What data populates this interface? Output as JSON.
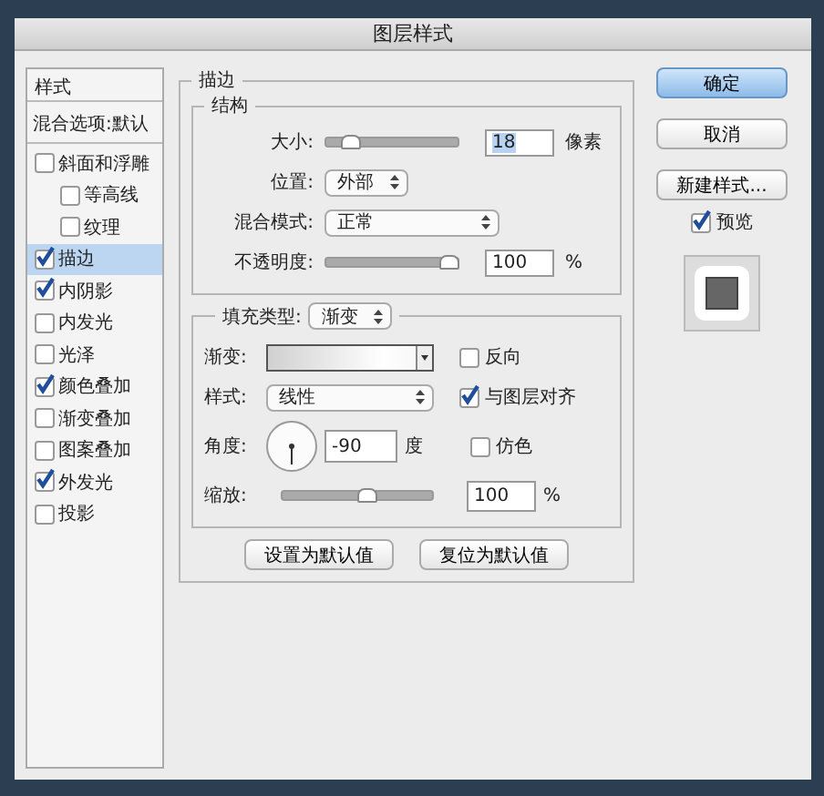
{
  "window": {
    "title": "图层样式"
  },
  "sidebar": {
    "header": "样式",
    "blending_options": "混合选项:默认",
    "items": [
      {
        "label": "斜面和浮雕",
        "checked": false,
        "selected": false,
        "children": [
          {
            "label": "等高线",
            "checked": false,
            "selected": false
          },
          {
            "label": "纹理",
            "checked": false,
            "selected": false
          }
        ]
      },
      {
        "label": "描边",
        "checked": true,
        "selected": true
      },
      {
        "label": "内阴影",
        "checked": true,
        "selected": false
      },
      {
        "label": "内发光",
        "checked": false,
        "selected": false
      },
      {
        "label": "光泽",
        "checked": false,
        "selected": false
      },
      {
        "label": "颜色叠加",
        "checked": true,
        "selected": false
      },
      {
        "label": "渐变叠加",
        "checked": false,
        "selected": false
      },
      {
        "label": "图案叠加",
        "checked": false,
        "selected": false
      },
      {
        "label": "外发光",
        "checked": true,
        "selected": false
      },
      {
        "label": "投影",
        "checked": false,
        "selected": false
      }
    ]
  },
  "stroke": {
    "title": "描边",
    "structure": {
      "title": "结构",
      "size": {
        "label": "大小:",
        "level": 0.15,
        "value": "18",
        "unit": "像素"
      },
      "position": {
        "label": "位置:",
        "value": "外部"
      },
      "blend_mode": {
        "label": "混合模式:",
        "value": "正常"
      },
      "opacity": {
        "label": "不透明度:",
        "level": 1,
        "value": "100",
        "unit": "%"
      }
    },
    "fill": {
      "label": "填充类型:",
      "value": "渐变",
      "gradient": {
        "label": "渐变:"
      },
      "reverse": {
        "label": "反向",
        "checked": false
      },
      "style": {
        "label": "样式:",
        "value": "线性"
      },
      "align": {
        "label": "与图层对齐",
        "checked": true
      },
      "angle": {
        "label": "角度:",
        "value": "-90",
        "unit": "度"
      },
      "dither": {
        "label": "仿色",
        "checked": false
      },
      "scale": {
        "label": "缩放:",
        "level": 0.58,
        "value": "100",
        "unit": "%"
      }
    },
    "buttons": [
      "设置为默认值",
      "复位为默认值"
    ]
  },
  "actions": {
    "buttons": [
      {
        "label": "确定",
        "kind": "default"
      },
      {
        "label": "取消",
        "kind": "normal"
      },
      {
        "label": "新建样式...",
        "kind": "normal"
      }
    ],
    "preview": {
      "label": "预览",
      "checked": true
    }
  }
}
